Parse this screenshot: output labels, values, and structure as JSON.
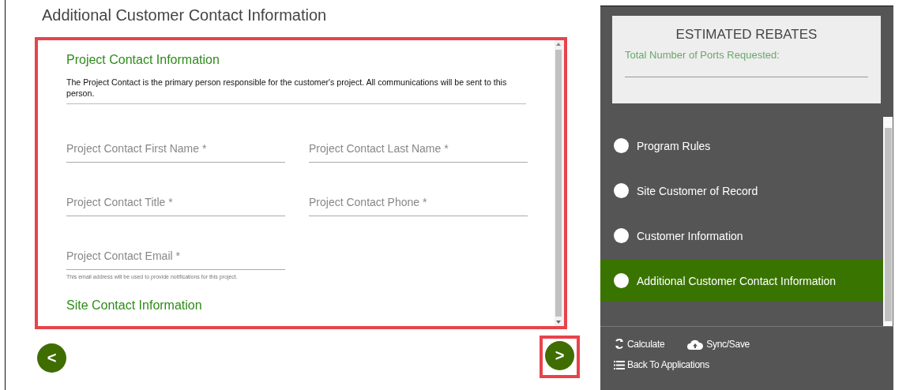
{
  "page_title": "Additional Customer Contact Information",
  "form": {
    "section_title": "Project Contact Information",
    "description": "The Project Contact is the primary person responsible for the customer's project. All communications will be sent to this person.",
    "fields": [
      {
        "placeholder": "Project Contact First Name *"
      },
      {
        "placeholder": "Project Contact Last Name *"
      },
      {
        "placeholder": "Project Contact Title *"
      },
      {
        "placeholder": "Project Contact Phone *"
      },
      {
        "placeholder": "Project Contact Email *",
        "hint": "This email address will be used to provide notifications for this project."
      }
    ],
    "next_section_title": "Site Contact Information"
  },
  "nav_buttons": [
    {
      "label": "<",
      "highlighted": false
    },
    {
      "label": ">",
      "highlighted": true
    }
  ],
  "sidebar": {
    "rebates_title": "ESTIMATED REBATES",
    "ports_label": "Total Number of Ports Requested:",
    "steps": [
      {
        "label": "Program Rules",
        "selected": false
      },
      {
        "label": "Site Customer of Record",
        "selected": false
      },
      {
        "label": "Customer Information",
        "selected": false
      },
      {
        "label": "Additional Customer Contact Information",
        "selected": true
      }
    ],
    "actions": [
      {
        "kind": "calculate",
        "label": "Calculate"
      },
      {
        "kind": "sync",
        "label": "Sync/Save"
      },
      {
        "kind": "back",
        "label": "Back To Applications"
      }
    ]
  }
}
